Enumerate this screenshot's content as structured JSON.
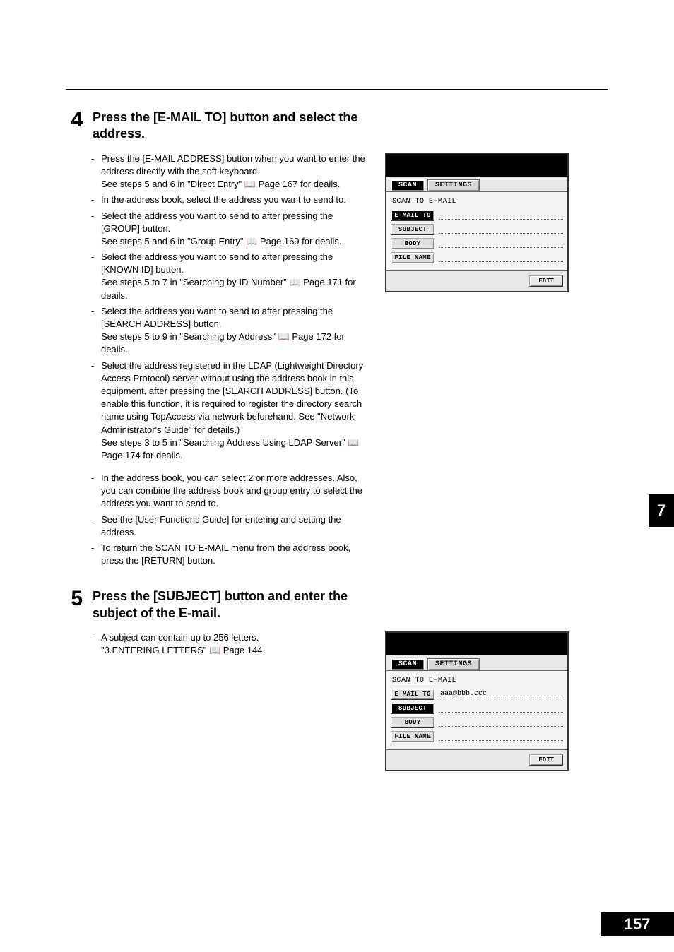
{
  "side_chapter": "7",
  "page_number": "157",
  "step4": {
    "num": "4",
    "title": "Press the [E-MAIL TO] button and select the address.",
    "bullets": [
      "Press the [E-MAIL ADDRESS] button when you want to enter the address directly with the soft keyboard.\nSee steps 5 and 6 in \"Direct Entry\" 📖 Page 167 for deails.",
      "In the address book, select the address you want to send to.",
      "Select the address you want to send to after pressing the [GROUP] button.\nSee steps 5 and 6 in \"Group Entry\" 📖 Page 169 for deails.",
      "Select the address you want to send to after pressing the [KNOWN ID] button.\nSee steps 5 to 7 in \"Searching by ID Number\" 📖 Page 171 for deails.",
      "Select the address you want to send to after pressing the [SEARCH ADDRESS] button.\nSee steps 5 to 9 in \"Searching by Address\" 📖 Page 172 for deails.",
      "Select the address registered in the LDAP (Lightweight Directory Access Protocol) server without using the address book in this equipment, after pressing the [SEARCH ADDRESS] button. (To enable this function, it is required to register the directory search name using TopAccess via network beforehand. See \"Network Administrator's Guide\" for details.)\nSee steps 3 to 5 in \"Searching Address Using LDAP Server\" 📖 Page 174 for deails."
    ],
    "bullets2": [
      "In the address book, you can select 2 or more addresses. Also, you can combine the address book and group entry to select the address you want to send to.",
      "See the [User Functions Guide] for entering and setting the address.",
      "To return the SCAN TO E-MAIL menu from the address book, press the [RETURN] button."
    ]
  },
  "step5": {
    "num": "5",
    "title": "Press the [SUBJECT] button and enter the subject of the E-mail.",
    "bullets": [
      "A subject can contain up to 256 letters.\n\"3.ENTERING LETTERS\" 📖 Page 144"
    ]
  },
  "screen": {
    "tab_scan": "SCAN",
    "tab_settings": "SETTINGS",
    "header": "SCAN TO E-MAIL",
    "btn_emailto": "E-MAIL TO",
    "btn_subject": "SUBJECT",
    "btn_body": "BODY",
    "btn_filename": "FILE NAME",
    "btn_edit": "EDIT",
    "email_value": "aaa@bbb.ccc"
  }
}
